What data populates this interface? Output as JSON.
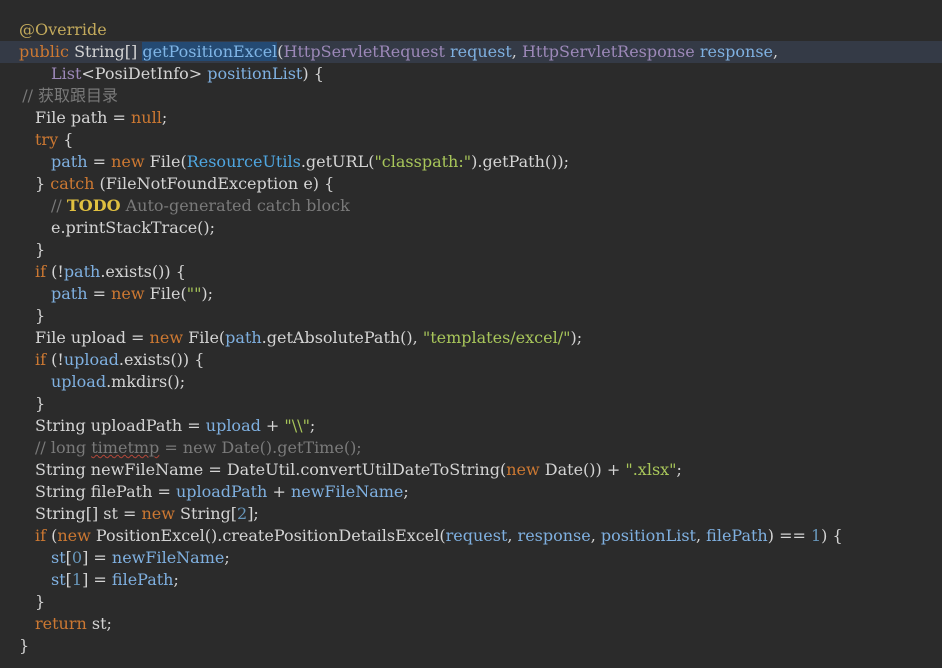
{
  "editor": {
    "lines": [
      {
        "indent": 0,
        "tokens": [
          {
            "t": "@Override",
            "c": "ann"
          }
        ]
      },
      {
        "indent": 0,
        "current": true,
        "tokens": [
          {
            "t": "public",
            "c": "kw"
          },
          {
            "t": " String[] ",
            "c": "def"
          },
          {
            "t": "getPositionExcel",
            "c": "fn",
            "sel": true
          },
          {
            "t": "(",
            "c": "def"
          },
          {
            "t": "HttpServletRequest",
            "c": "type"
          },
          {
            "t": " ",
            "c": "def"
          },
          {
            "t": "request",
            "c": "param"
          },
          {
            "t": ", ",
            "c": "def"
          },
          {
            "t": "HttpServletResponse",
            "c": "type"
          },
          {
            "t": " ",
            "c": "def"
          },
          {
            "t": "response",
            "c": "param"
          },
          {
            "t": ",",
            "c": "def"
          }
        ]
      },
      {
        "indent": 1,
        "tokens": [
          {
            "t": "List",
            "c": "type"
          },
          {
            "t": "<PosiDetInfo> ",
            "c": "def"
          },
          {
            "t": "positionList",
            "c": "param"
          },
          {
            "t": ") {",
            "c": "def"
          }
        ]
      },
      {
        "indent": 0.1,
        "tokens": [
          {
            "t": "// 获取跟目录",
            "c": "cmt"
          }
        ]
      },
      {
        "indent": 0.5,
        "tokens": [
          {
            "t": "File path = ",
            "c": "def"
          },
          {
            "t": "null",
            "c": "kw"
          },
          {
            "t": ";",
            "c": "def"
          }
        ]
      },
      {
        "indent": 0.5,
        "tokens": [
          {
            "t": "try",
            "c": "kw"
          },
          {
            "t": " {",
            "c": "def"
          }
        ]
      },
      {
        "indent": 1,
        "tokens": [
          {
            "t": "path",
            "c": "var"
          },
          {
            "t": " = ",
            "c": "def"
          },
          {
            "t": "new",
            "c": "kw"
          },
          {
            "t": " File(",
            "c": "def"
          },
          {
            "t": "ResourceUtils",
            "c": "class"
          },
          {
            "t": ".getURL(",
            "c": "def"
          },
          {
            "t": "\"classpath:\"",
            "c": "str"
          },
          {
            "t": ").getPath());",
            "c": "def"
          }
        ]
      },
      {
        "indent": 0.5,
        "tokens": [
          {
            "t": "} ",
            "c": "def"
          },
          {
            "t": "catch",
            "c": "kw"
          },
          {
            "t": " (FileNotFoundException e) {",
            "c": "def"
          }
        ]
      },
      {
        "indent": 1,
        "tokens": [
          {
            "t": "// ",
            "c": "cmt"
          },
          {
            "t": "TODO",
            "c": "todo"
          },
          {
            "t": " Auto-generated catch block",
            "c": "cmt"
          }
        ]
      },
      {
        "indent": 1,
        "tokens": [
          {
            "t": "e.printStackTrace();",
            "c": "def"
          }
        ]
      },
      {
        "indent": 0.5,
        "tokens": [
          {
            "t": "}",
            "c": "def"
          }
        ]
      },
      {
        "indent": 0.5,
        "tokens": [
          {
            "t": "if",
            "c": "kw"
          },
          {
            "t": " (!",
            "c": "def"
          },
          {
            "t": "path",
            "c": "var"
          },
          {
            "t": ".exists()) {",
            "c": "def"
          }
        ]
      },
      {
        "indent": 1,
        "tokens": [
          {
            "t": "path",
            "c": "var"
          },
          {
            "t": " = ",
            "c": "def"
          },
          {
            "t": "new",
            "c": "kw"
          },
          {
            "t": " File(",
            "c": "def"
          },
          {
            "t": "\"\"",
            "c": "str"
          },
          {
            "t": ");",
            "c": "def"
          }
        ]
      },
      {
        "indent": 0.5,
        "tokens": [
          {
            "t": "}",
            "c": "def"
          }
        ]
      },
      {
        "indent": 0.5,
        "tokens": [
          {
            "t": "File upload = ",
            "c": "def"
          },
          {
            "t": "new",
            "c": "kw"
          },
          {
            "t": " File(",
            "c": "def"
          },
          {
            "t": "path",
            "c": "var"
          },
          {
            "t": ".getAbsolutePath(), ",
            "c": "def"
          },
          {
            "t": "\"templates/excel/\"",
            "c": "str"
          },
          {
            "t": ");",
            "c": "def"
          }
        ]
      },
      {
        "indent": 0.5,
        "tokens": [
          {
            "t": "if",
            "c": "kw"
          },
          {
            "t": " (!",
            "c": "def"
          },
          {
            "t": "upload",
            "c": "var"
          },
          {
            "t": ".exists()) {",
            "c": "def"
          }
        ]
      },
      {
        "indent": 1,
        "tokens": [
          {
            "t": "upload",
            "c": "var"
          },
          {
            "t": ".mkdirs();",
            "c": "def"
          }
        ]
      },
      {
        "indent": 0.5,
        "tokens": [
          {
            "t": "}",
            "c": "def"
          }
        ]
      },
      {
        "indent": 0.5,
        "tokens": [
          {
            "t": "String uploadPath = ",
            "c": "def"
          },
          {
            "t": "upload",
            "c": "var"
          },
          {
            "t": " + ",
            "c": "def"
          },
          {
            "t": "\"\\\\\"",
            "c": "str"
          },
          {
            "t": ";",
            "c": "def"
          }
        ]
      },
      {
        "indent": 0.5,
        "tokens": [
          {
            "t": "// long ",
            "c": "cmt"
          },
          {
            "t": "timetmp",
            "c": "cmt",
            "wavy": true
          },
          {
            "t": " = new Date().getTime();",
            "c": "cmt"
          }
        ]
      },
      {
        "indent": 0.5,
        "tokens": [
          {
            "t": "String newFileName = DateUtil.convertUtilDateToString(",
            "c": "def"
          },
          {
            "t": "new",
            "c": "kw"
          },
          {
            "t": " Date()) + ",
            "c": "def"
          },
          {
            "t": "\".xlsx\"",
            "c": "str"
          },
          {
            "t": ";",
            "c": "def"
          }
        ]
      },
      {
        "indent": 0.5,
        "tokens": [
          {
            "t": "String filePath = ",
            "c": "def"
          },
          {
            "t": "uploadPath",
            "c": "var"
          },
          {
            "t": " + ",
            "c": "def"
          },
          {
            "t": "newFileName",
            "c": "var"
          },
          {
            "t": ";",
            "c": "def"
          }
        ]
      },
      {
        "indent": 0.5,
        "tokens": [
          {
            "t": "String[] st = ",
            "c": "def"
          },
          {
            "t": "new",
            "c": "kw"
          },
          {
            "t": " String[",
            "c": "def"
          },
          {
            "t": "2",
            "c": "num"
          },
          {
            "t": "];",
            "c": "def"
          }
        ]
      },
      {
        "indent": 0.5,
        "tokens": [
          {
            "t": "if",
            "c": "kw"
          },
          {
            "t": " (",
            "c": "def"
          },
          {
            "t": "new",
            "c": "kw"
          },
          {
            "t": " PositionExcel().createPositionDetailsExcel(",
            "c": "def"
          },
          {
            "t": "request",
            "c": "var"
          },
          {
            "t": ", ",
            "c": "def"
          },
          {
            "t": "response",
            "c": "var"
          },
          {
            "t": ", ",
            "c": "def"
          },
          {
            "t": "positionList",
            "c": "var"
          },
          {
            "t": ", ",
            "c": "def"
          },
          {
            "t": "filePath",
            "c": "var"
          },
          {
            "t": ") == ",
            "c": "def"
          },
          {
            "t": "1",
            "c": "num"
          },
          {
            "t": ") {",
            "c": "def"
          }
        ]
      },
      {
        "indent": 1,
        "tokens": [
          {
            "t": "st",
            "c": "var"
          },
          {
            "t": "[",
            "c": "def"
          },
          {
            "t": "0",
            "c": "num"
          },
          {
            "t": "] = ",
            "c": "def"
          },
          {
            "t": "newFileName",
            "c": "var"
          },
          {
            "t": ";",
            "c": "def"
          }
        ]
      },
      {
        "indent": 1,
        "tokens": [
          {
            "t": "st",
            "c": "var"
          },
          {
            "t": "[",
            "c": "def"
          },
          {
            "t": "1",
            "c": "num"
          },
          {
            "t": "] = ",
            "c": "def"
          },
          {
            "t": "filePath",
            "c": "var"
          },
          {
            "t": ";",
            "c": "def"
          }
        ]
      },
      {
        "indent": 0.5,
        "tokens": [
          {
            "t": "}",
            "c": "def"
          }
        ]
      },
      {
        "indent": 0.5,
        "tokens": [
          {
            "t": "return",
            "c": "kw"
          },
          {
            "t": " st;",
            "c": "def"
          }
        ]
      },
      {
        "indent": 0,
        "tokens": [
          {
            "t": "}",
            "c": "def"
          }
        ]
      }
    ]
  }
}
